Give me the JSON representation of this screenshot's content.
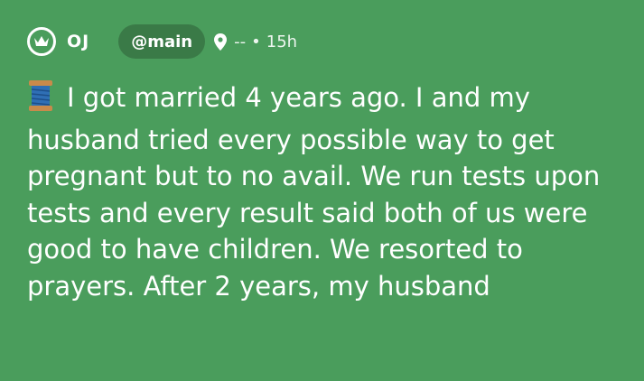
{
  "header": {
    "username": "OJ",
    "channel": "@main",
    "location": "--",
    "separator": "•",
    "time": "15h"
  },
  "post": {
    "emoji_icon": "thread-spool-icon",
    "text": "I got married 4 years ago. I and my husband tried every possible way to get pregnant but to no avail. We run tests upon tests and every result said both of us were good to have children. We resorted to prayers. After 2 years, my husband"
  },
  "colors": {
    "background": "#4a9d5c",
    "channel_pill": "#3a7a47",
    "text": "#ffffff"
  }
}
